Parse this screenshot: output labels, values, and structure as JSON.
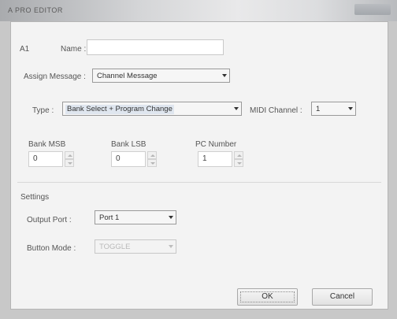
{
  "window": {
    "title": "A PRO EDITOR"
  },
  "form": {
    "index_label": "A1",
    "name_label": "Name :",
    "name_value": "",
    "assign_label": "Assign Message :",
    "assign_value": "Channel Message",
    "type_label": "Type :",
    "type_value": "Bank Select + Program Change",
    "midi_label": "MIDI Channel :",
    "midi_value": "1",
    "bank_msb_label": "Bank MSB",
    "bank_msb_value": "0",
    "bank_lsb_label": "Bank LSB",
    "bank_lsb_value": "0",
    "pc_label": "PC Number",
    "pc_value": "1"
  },
  "settings": {
    "heading": "Settings",
    "output_label": "Output Port :",
    "output_value": "Port 1",
    "button_mode_label": "Button Mode :",
    "button_mode_value": "TOGGLE"
  },
  "buttons": {
    "ok": "OK",
    "cancel": "Cancel"
  }
}
